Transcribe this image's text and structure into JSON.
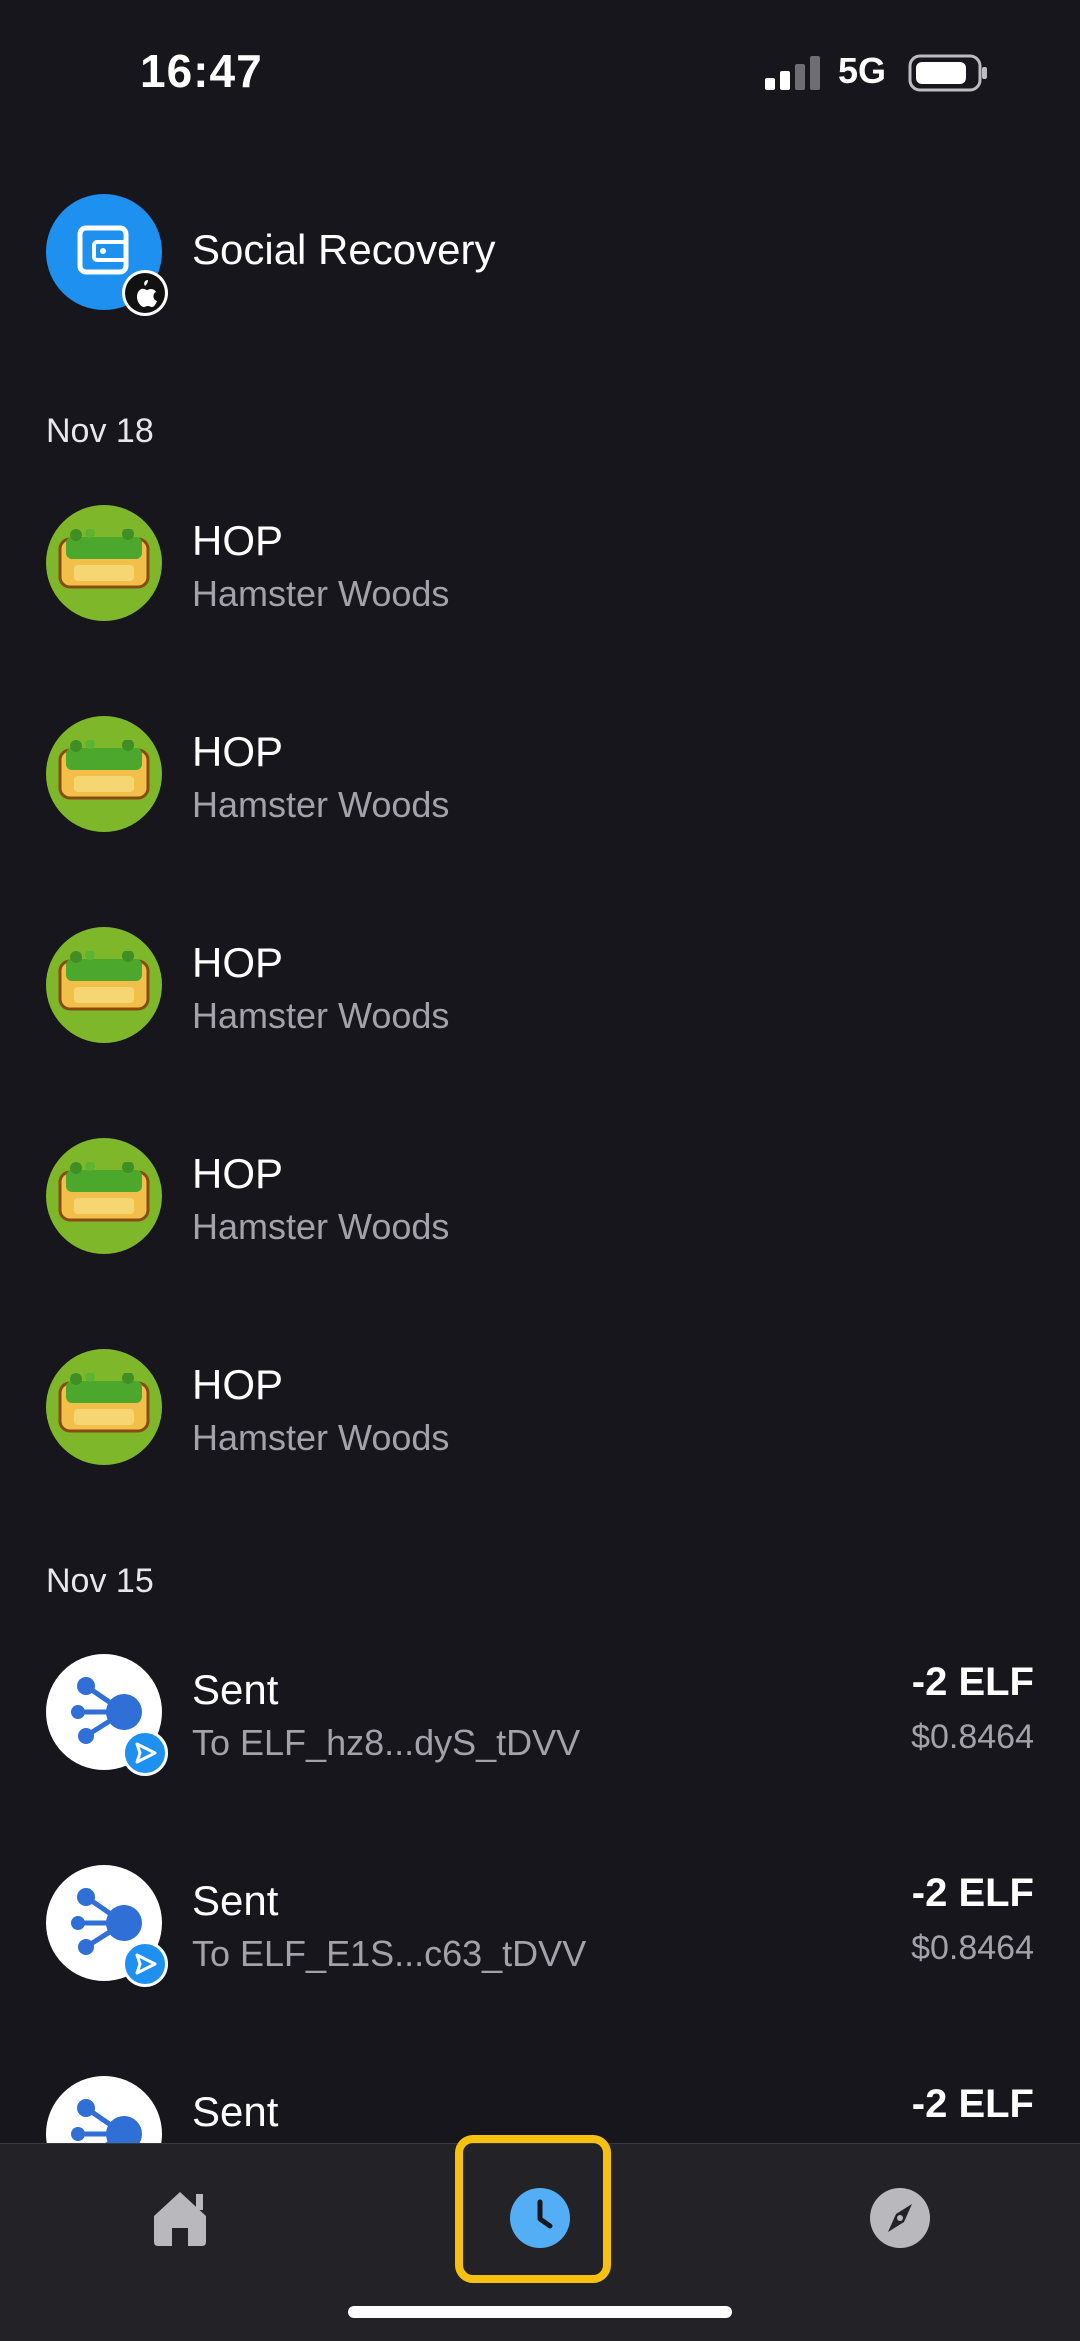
{
  "status_bar": {
    "time": "16:47",
    "network": "5G"
  },
  "social_recovery": {
    "title": "Social Recovery",
    "badge_icon": "apple-icon"
  },
  "sections": [
    {
      "date": "Nov 18",
      "items": [
        {
          "title": "HOP",
          "subtitle": "Hamster Woods"
        },
        {
          "title": "HOP",
          "subtitle": "Hamster Woods"
        },
        {
          "title": "HOP",
          "subtitle": "Hamster Woods"
        },
        {
          "title": "HOP",
          "subtitle": "Hamster Woods"
        },
        {
          "title": "HOP",
          "subtitle": "Hamster Woods"
        }
      ]
    },
    {
      "date": "Nov 15",
      "items": [
        {
          "title": "Sent",
          "subtitle": "To ELF_hz8...dyS_tDVV",
          "amount": "-2 ELF",
          "usd": "$0.8464"
        },
        {
          "title": "Sent",
          "subtitle": "To ELF_E1S...c63_tDVV",
          "amount": "-2 ELF",
          "usd": "$0.8464"
        },
        {
          "title": "Sent",
          "subtitle": "",
          "amount": "-2 ELF",
          "usd": ""
        }
      ]
    }
  ],
  "nav": {
    "items": [
      {
        "icon": "home-icon"
      },
      {
        "icon": "clock-icon",
        "active": true
      },
      {
        "icon": "compass-icon"
      }
    ]
  },
  "colors": {
    "background": "#17161c",
    "nav_background": "#232227",
    "accent_blue": "#54aef5",
    "highlight": "#f7c20f",
    "secondary_text": "#a3a1aa"
  }
}
